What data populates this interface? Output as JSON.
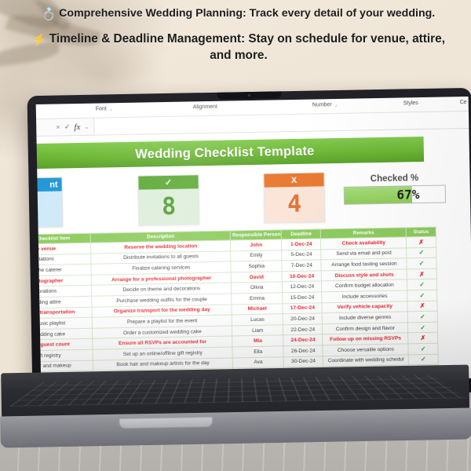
{
  "headline": {
    "line1_emoji": "💍",
    "line1": "Comprehensive Wedding Planning: Track every detail of your wedding.",
    "line2_emoji": "⚡",
    "line2": "Timeline & Deadline Management: Stay on schedule for venue, attire, and more."
  },
  "ribbon": {
    "groups": [
      {
        "label": "Font",
        "dialog": "⌐"
      },
      {
        "label": "Alignment",
        "dialog": ""
      },
      {
        "label": "Number",
        "dialog": "⌐"
      },
      {
        "label": "Styles",
        "dialog": ""
      },
      {
        "label": "Ce",
        "dialog": ""
      }
    ]
  },
  "formula_bar": {
    "cancel_icon": "✕",
    "confirm_icon": "✓",
    "fx_icon": "fx",
    "chevron_icon": "⌄",
    "value": "",
    "placeholder": ""
  },
  "sheet": {
    "title": "Wedding Checklist Template"
  },
  "kpis": {
    "blue": {
      "label": "nt",
      "value": ""
    },
    "green": {
      "label": "✓",
      "value": "8",
      "color": "#5aa832"
    },
    "orange": {
      "label": "X",
      "value": "4",
      "color": "#e8762c"
    },
    "gauge": {
      "label": "Checked %",
      "value": "67%",
      "percent": 67,
      "color": "#8ccd55"
    }
  },
  "table": {
    "headers": [
      "Checklist Item",
      "Description",
      "Responsible Person",
      "Deadline",
      "Remarks",
      "Status"
    ],
    "rows": [
      {
        "item": "Book the venue",
        "desc": "Reserve the wedding location",
        "person": "John",
        "deadline": "1-Dec-24",
        "remark": "Check availability",
        "status": "✗",
        "flag": true
      },
      {
        "item": "Send invitations",
        "desc": "Distribute invitations to all guests",
        "person": "Emily",
        "deadline": "5-Dec-24",
        "remark": "Send via email and post",
        "status": "✓",
        "flag": false
      },
      {
        "item": "Choose the caterer",
        "desc": "Finalize catering services",
        "person": "Sophia",
        "deadline": "7-Dec-24",
        "remark": "Arrange food tasting session",
        "status": "✓",
        "flag": false
      },
      {
        "item": "Hire photographer",
        "desc": "Arrange for a professional photographer",
        "person": "David",
        "deadline": "10-Dec-24",
        "remark": "Discuss style and shots",
        "status": "✗",
        "flag": true
      },
      {
        "item": "Plan decorations",
        "desc": "Decide on theme and decorations",
        "person": "Olivia",
        "deadline": "12-Dec-24",
        "remark": "Confirm budget allocation",
        "status": "✓",
        "flag": false
      },
      {
        "item": "Buy wedding attire",
        "desc": "Purchase wedding outfits for the couple",
        "person": "Emma",
        "deadline": "15-Dec-24",
        "remark": "Include accessories",
        "status": "✓",
        "flag": false
      },
      {
        "item": "Arrange transportation",
        "desc": "Organize transport for the wedding day",
        "person": "Michael",
        "deadline": "17-Dec-24",
        "remark": "Verify vehicle capacity",
        "status": "✗",
        "flag": true
      },
      {
        "item": "Select music playlist",
        "desc": "Prepare a playlist for the event",
        "person": "Lucas",
        "deadline": "20-Dec-24",
        "remark": "Include diverse genres",
        "status": "✓",
        "flag": false
      },
      {
        "item": "Order wedding cake",
        "desc": "Order a customized wedding cake",
        "person": "Liam",
        "deadline": "22-Dec-24",
        "remark": "Confirm design and flavor",
        "status": "✓",
        "flag": false
      },
      {
        "item": "Confirm guest count",
        "desc": "Ensure all RSVPs are accounted for",
        "person": "Mia",
        "deadline": "24-Dec-24",
        "remark": "Follow up on missing RSVPs",
        "status": "✗",
        "flag": true
      },
      {
        "item": "Set up gift registry",
        "desc": "Set up an online/offline gift registry",
        "person": "Ella",
        "deadline": "26-Dec-24",
        "remark": "Choose versatile options",
        "status": "✓",
        "flag": false
      },
      {
        "item": "Book hair and makeup",
        "desc": "Book hair and makeup artists for the day",
        "person": "Ava",
        "deadline": "30-Dec-24",
        "remark": "Coordinate with wedding schedul",
        "status": "✓",
        "flag": false
      }
    ],
    "empty_rows": 4
  },
  "colors": {
    "brand_green": "#6ab631",
    "header_green": "#8ccb5c",
    "flag_red": "#e8262c",
    "check_green": "#2e9e4f",
    "orange": "#e8762c",
    "blue": "#2196d6",
    "background": "#efe6d8"
  }
}
